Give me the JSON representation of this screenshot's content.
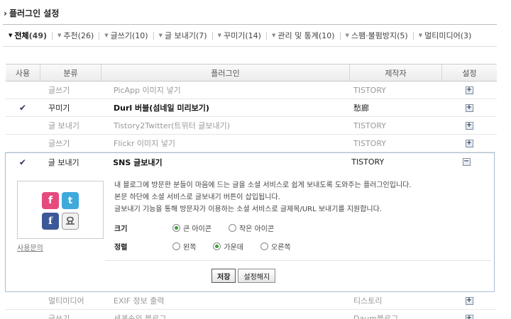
{
  "page_title": "플러그인 설정",
  "filters": [
    {
      "label": "전체",
      "count": "(49)",
      "active": true
    },
    {
      "label": "추천",
      "count": "(26)"
    },
    {
      "label": "글쓰기",
      "count": "(10)"
    },
    {
      "label": "글 보내기",
      "count": "(7)"
    },
    {
      "label": "꾸미기",
      "count": "(14)"
    },
    {
      "label": "관리 및 통계",
      "count": "(10)"
    },
    {
      "label": "스팸·불펌방지",
      "count": "(5)"
    },
    {
      "label": "멀티미디어",
      "count": "(3)"
    }
  ],
  "table": {
    "headers": [
      "사용",
      "분류",
      "플러그인",
      "제작자",
      "설정"
    ],
    "rows_top": [
      {
        "use": "",
        "category": "글쓰기",
        "name": "PicApp 이미지 넣기",
        "maker": "TISTORY",
        "toggle": "+"
      },
      {
        "use": "✔",
        "category": "꾸미기",
        "name": "Durl 버블(섬네일 미리보기)",
        "maker": "愁廊",
        "toggle": "+"
      },
      {
        "use": "",
        "category": "글 보내기",
        "name": "Tistory2Twitter(트위터 글보내기)",
        "maker": "TISTORY",
        "toggle": "+"
      },
      {
        "use": "",
        "category": "글쓰기",
        "name": "Flickr 이미지 넣기",
        "maker": "TISTORY",
        "toggle": "+"
      }
    ],
    "expanded_row": {
      "use": "✔",
      "category": "글 보내기",
      "name": "SNS 글보내기",
      "maker": "TISTORY",
      "toggle": "−"
    },
    "rows_bottom": [
      {
        "use": "",
        "category": "멀티미디어",
        "name": "EXIF 정보 출력",
        "maker": "티스토리",
        "toggle": "+"
      },
      {
        "use": "",
        "category": "글쓰기",
        "name": "세계속의 블로그",
        "maker": "Daum블로그",
        "toggle": "+"
      }
    ]
  },
  "detail": {
    "icons": [
      "f",
      "t",
      "f",
      "요"
    ],
    "inquiry_label": "사용문의",
    "description": [
      "내 블로그에 방문한 분들이 마음에 드는 글을 소셜 서비스로 쉽게 보내도록 도와주는 플러그인입니다.",
      "본문 하단에 소셜 서비스로 글보내기 버튼이 삽입됩니다.",
      "글보내기 기능을 통해 방문자가 이용하는 소셜 서비스로 글제목/URL 보내기를 지원합니다."
    ],
    "size_option": {
      "label": "크기",
      "options": [
        "큰 아이콘",
        "작은 아이콘"
      ],
      "selected": 0
    },
    "align_option": {
      "label": "정렬",
      "options": [
        "왼쪽",
        "가운데",
        "오른쪽"
      ],
      "selected": 1
    },
    "save_label": "저장",
    "unset_label": "설정해지"
  }
}
